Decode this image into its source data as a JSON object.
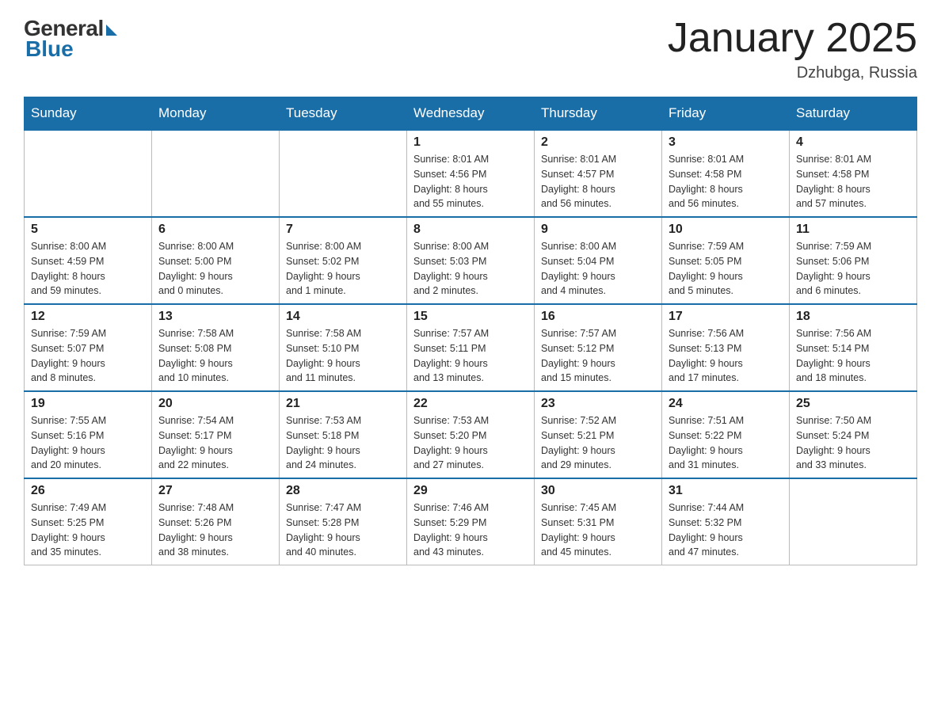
{
  "header": {
    "logo_general": "General",
    "logo_blue": "Blue",
    "month_title": "January 2025",
    "location": "Dzhubga, Russia"
  },
  "weekdays": [
    "Sunday",
    "Monday",
    "Tuesday",
    "Wednesday",
    "Thursday",
    "Friday",
    "Saturday"
  ],
  "weeks": [
    [
      {
        "day": "",
        "info": ""
      },
      {
        "day": "",
        "info": ""
      },
      {
        "day": "",
        "info": ""
      },
      {
        "day": "1",
        "info": "Sunrise: 8:01 AM\nSunset: 4:56 PM\nDaylight: 8 hours\nand 55 minutes."
      },
      {
        "day": "2",
        "info": "Sunrise: 8:01 AM\nSunset: 4:57 PM\nDaylight: 8 hours\nand 56 minutes."
      },
      {
        "day": "3",
        "info": "Sunrise: 8:01 AM\nSunset: 4:58 PM\nDaylight: 8 hours\nand 56 minutes."
      },
      {
        "day": "4",
        "info": "Sunrise: 8:01 AM\nSunset: 4:58 PM\nDaylight: 8 hours\nand 57 minutes."
      }
    ],
    [
      {
        "day": "5",
        "info": "Sunrise: 8:00 AM\nSunset: 4:59 PM\nDaylight: 8 hours\nand 59 minutes."
      },
      {
        "day": "6",
        "info": "Sunrise: 8:00 AM\nSunset: 5:00 PM\nDaylight: 9 hours\nand 0 minutes."
      },
      {
        "day": "7",
        "info": "Sunrise: 8:00 AM\nSunset: 5:02 PM\nDaylight: 9 hours\nand 1 minute."
      },
      {
        "day": "8",
        "info": "Sunrise: 8:00 AM\nSunset: 5:03 PM\nDaylight: 9 hours\nand 2 minutes."
      },
      {
        "day": "9",
        "info": "Sunrise: 8:00 AM\nSunset: 5:04 PM\nDaylight: 9 hours\nand 4 minutes."
      },
      {
        "day": "10",
        "info": "Sunrise: 7:59 AM\nSunset: 5:05 PM\nDaylight: 9 hours\nand 5 minutes."
      },
      {
        "day": "11",
        "info": "Sunrise: 7:59 AM\nSunset: 5:06 PM\nDaylight: 9 hours\nand 6 minutes."
      }
    ],
    [
      {
        "day": "12",
        "info": "Sunrise: 7:59 AM\nSunset: 5:07 PM\nDaylight: 9 hours\nand 8 minutes."
      },
      {
        "day": "13",
        "info": "Sunrise: 7:58 AM\nSunset: 5:08 PM\nDaylight: 9 hours\nand 10 minutes."
      },
      {
        "day": "14",
        "info": "Sunrise: 7:58 AM\nSunset: 5:10 PM\nDaylight: 9 hours\nand 11 minutes."
      },
      {
        "day": "15",
        "info": "Sunrise: 7:57 AM\nSunset: 5:11 PM\nDaylight: 9 hours\nand 13 minutes."
      },
      {
        "day": "16",
        "info": "Sunrise: 7:57 AM\nSunset: 5:12 PM\nDaylight: 9 hours\nand 15 minutes."
      },
      {
        "day": "17",
        "info": "Sunrise: 7:56 AM\nSunset: 5:13 PM\nDaylight: 9 hours\nand 17 minutes."
      },
      {
        "day": "18",
        "info": "Sunrise: 7:56 AM\nSunset: 5:14 PM\nDaylight: 9 hours\nand 18 minutes."
      }
    ],
    [
      {
        "day": "19",
        "info": "Sunrise: 7:55 AM\nSunset: 5:16 PM\nDaylight: 9 hours\nand 20 minutes."
      },
      {
        "day": "20",
        "info": "Sunrise: 7:54 AM\nSunset: 5:17 PM\nDaylight: 9 hours\nand 22 minutes."
      },
      {
        "day": "21",
        "info": "Sunrise: 7:53 AM\nSunset: 5:18 PM\nDaylight: 9 hours\nand 24 minutes."
      },
      {
        "day": "22",
        "info": "Sunrise: 7:53 AM\nSunset: 5:20 PM\nDaylight: 9 hours\nand 27 minutes."
      },
      {
        "day": "23",
        "info": "Sunrise: 7:52 AM\nSunset: 5:21 PM\nDaylight: 9 hours\nand 29 minutes."
      },
      {
        "day": "24",
        "info": "Sunrise: 7:51 AM\nSunset: 5:22 PM\nDaylight: 9 hours\nand 31 minutes."
      },
      {
        "day": "25",
        "info": "Sunrise: 7:50 AM\nSunset: 5:24 PM\nDaylight: 9 hours\nand 33 minutes."
      }
    ],
    [
      {
        "day": "26",
        "info": "Sunrise: 7:49 AM\nSunset: 5:25 PM\nDaylight: 9 hours\nand 35 minutes."
      },
      {
        "day": "27",
        "info": "Sunrise: 7:48 AM\nSunset: 5:26 PM\nDaylight: 9 hours\nand 38 minutes."
      },
      {
        "day": "28",
        "info": "Sunrise: 7:47 AM\nSunset: 5:28 PM\nDaylight: 9 hours\nand 40 minutes."
      },
      {
        "day": "29",
        "info": "Sunrise: 7:46 AM\nSunset: 5:29 PM\nDaylight: 9 hours\nand 43 minutes."
      },
      {
        "day": "30",
        "info": "Sunrise: 7:45 AM\nSunset: 5:31 PM\nDaylight: 9 hours\nand 45 minutes."
      },
      {
        "day": "31",
        "info": "Sunrise: 7:44 AM\nSunset: 5:32 PM\nDaylight: 9 hours\nand 47 minutes."
      },
      {
        "day": "",
        "info": ""
      }
    ]
  ]
}
